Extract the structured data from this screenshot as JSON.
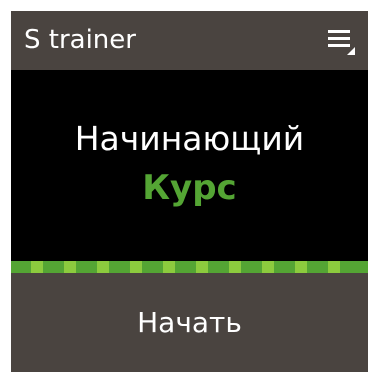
{
  "header": {
    "title": "S trainer",
    "menu_icon": "menu-icon"
  },
  "main": {
    "level": "Начинающий",
    "course": "Курс"
  },
  "footer": {
    "start_label": "Начать"
  },
  "colors": {
    "header_bg": "#4a4440",
    "content_bg": "#000000",
    "accent_green": "#54a534",
    "accent_light_green": "#8ccb3e",
    "text": "#ffffff"
  }
}
